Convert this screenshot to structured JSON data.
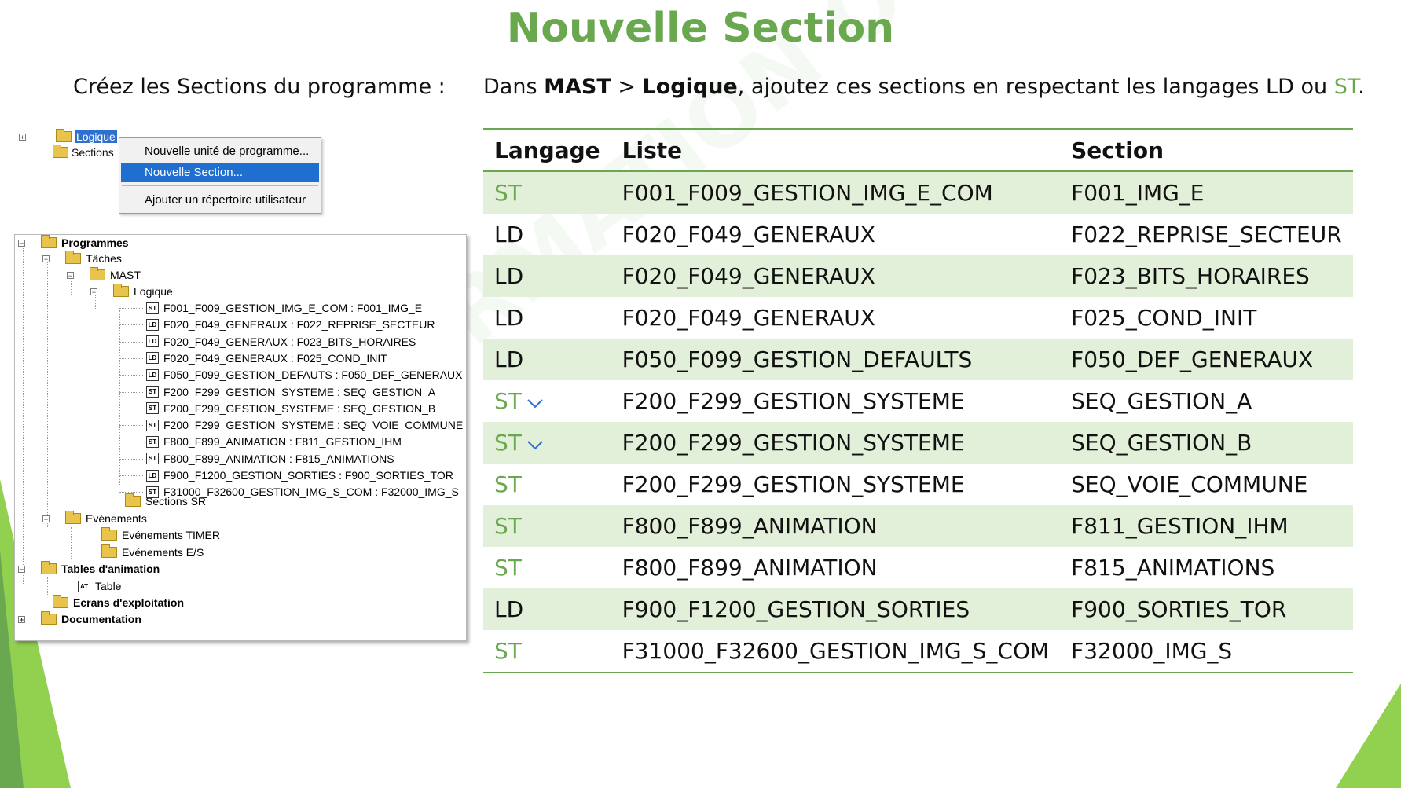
{
  "title": "Nouvelle Section",
  "left_intro": "Créez les Sections du programme :",
  "right_intro": {
    "prefix": "Dans ",
    "mast": "MAST",
    "sep": " > ",
    "logique": "Logique",
    "middle": ", ajoutez ces sections en respectant les langages LD ou ",
    "st": "ST",
    "end": "."
  },
  "watermark": "AFORMATION OUEST",
  "context_snippet": {
    "tree_logique": "Logique",
    "tree_sections": "Sections",
    "menu": [
      "Nouvelle unité de programme...",
      "Nouvelle Section...",
      "Ajouter un répertoire utilisateur"
    ],
    "active_index": 1
  },
  "tree": {
    "programmes": "Programmes",
    "taches": "Tâches",
    "mast": "MAST",
    "logique": "Logique",
    "sections": [
      {
        "lang": "ST",
        "label": "F001_F009_GESTION_IMG_E_COM : F001_IMG_E"
      },
      {
        "lang": "LD",
        "label": "F020_F049_GENERAUX : F022_REPRISE_SECTEUR"
      },
      {
        "lang": "LD",
        "label": "F020_F049_GENERAUX : F023_BITS_HORAIRES"
      },
      {
        "lang": "LD",
        "label": "F020_F049_GENERAUX : F025_COND_INIT"
      },
      {
        "lang": "LD",
        "label": "F050_F099_GESTION_DEFAUTS : F050_DEF_GENERAUX"
      },
      {
        "lang": "ST",
        "label": "F200_F299_GESTION_SYSTEME : SEQ_GESTION_A"
      },
      {
        "lang": "ST",
        "label": "F200_F299_GESTION_SYSTEME : SEQ_GESTION_B"
      },
      {
        "lang": "ST",
        "label": "F200_F299_GESTION_SYSTEME : SEQ_VOIE_COMMUNE"
      },
      {
        "lang": "ST",
        "label": "F800_F899_ANIMATION : F811_GESTION_IHM"
      },
      {
        "lang": "ST",
        "label": "F800_F899_ANIMATION : F815_ANIMATIONS"
      },
      {
        "lang": "LD",
        "label": "F900_F1200_GESTION_SORTIES : F900_SORTIES_TOR"
      },
      {
        "lang": "ST",
        "label": "F31000_F32600_GESTION_IMG_S_COM : F32000_IMG_S"
      }
    ],
    "sections_sr": "Sections SR",
    "evenements": "Evénements",
    "evenements_timer": "Evénements TIMER",
    "evenements_es": "Evénements E/S",
    "tables_animation": "Tables d'animation",
    "table": "Table",
    "table_icon": "AT",
    "ecrans": "Ecrans d'exploitation",
    "documentation": "Documentation"
  },
  "table": {
    "headers": [
      "Langage",
      "Liste",
      "Section"
    ],
    "rows": [
      {
        "lang": "ST",
        "liste": "F001_F009_GESTION_IMG_E_COM",
        "section": "F001_IMG_E",
        "check": false
      },
      {
        "lang": "LD",
        "liste": "F020_F049_GENERAUX",
        "section": "F022_REPRISE_SECTEUR",
        "check": false
      },
      {
        "lang": "LD",
        "liste": "F020_F049_GENERAUX",
        "section": "F023_BITS_HORAIRES",
        "check": false
      },
      {
        "lang": "LD",
        "liste": "F020_F049_GENERAUX",
        "section": "F025_COND_INIT",
        "check": false
      },
      {
        "lang": "LD",
        "liste": "F050_F099_GESTION_DEFAULTS",
        "section": "F050_DEF_GENERAUX",
        "check": false
      },
      {
        "lang": "ST",
        "liste": "F200_F299_GESTION_SYSTEME",
        "section": "SEQ_GESTION_A",
        "check": true
      },
      {
        "lang": "ST",
        "liste": "F200_F299_GESTION_SYSTEME",
        "section": "SEQ_GESTION_B",
        "check": true
      },
      {
        "lang": "ST",
        "liste": "F200_F299_GESTION_SYSTEME",
        "section": "SEQ_VOIE_COMMUNE",
        "check": false
      },
      {
        "lang": "ST",
        "liste": "F800_F899_ANIMATION",
        "section": "F811_GESTION_IHM",
        "check": false
      },
      {
        "lang": "ST",
        "liste": "F800_F899_ANIMATION",
        "section": "F815_ANIMATIONS",
        "check": false
      },
      {
        "lang": "LD",
        "liste": "F900_F1200_GESTION_SORTIES",
        "section": "F900_SORTIES_TOR",
        "check": false
      },
      {
        "lang": "ST",
        "liste": "F31000_F32600_GESTION_IMG_S_COM",
        "section": "F32000_IMG_S",
        "check": false
      }
    ]
  },
  "colors": {
    "accent_green": "#6aa84f",
    "row_band": "#e2efd9",
    "selection_blue": "#1f6fd1"
  }
}
